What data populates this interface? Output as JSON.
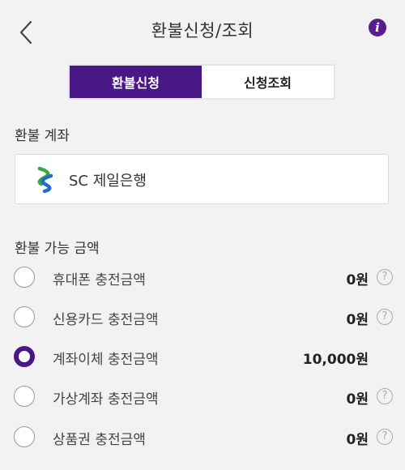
{
  "header": {
    "title": "환불신청/조회",
    "info_icon_glyph": "i",
    "icons": {
      "back": "chevron-left-icon",
      "info": "info-icon"
    }
  },
  "tabs": [
    {
      "label": "환불신청",
      "active": true
    },
    {
      "label": "신청조회",
      "active": false
    }
  ],
  "refund_account": {
    "label": "환불 계좌",
    "bank_name": "SC 제일은행",
    "bank_logo": "sc-bank-logo"
  },
  "refundable": {
    "label": "환불 가능 금액",
    "items": [
      {
        "label": "휴대폰 충전금액",
        "amount": "0원",
        "selected": false,
        "help": "?"
      },
      {
        "label": "신용카드 충전금액",
        "amount": "0원",
        "selected": false,
        "help": "?"
      },
      {
        "label": "계좌이체 충전금액",
        "amount": "10,000원",
        "selected": true,
        "help": ""
      },
      {
        "label": "가상계좌 충전금액",
        "amount": "0원",
        "selected": false,
        "help": "?"
      },
      {
        "label": "상품권 충전금액",
        "amount": "0원",
        "selected": false,
        "help": "?"
      }
    ]
  },
  "colors": {
    "accent": "#4a1786",
    "background": "#f2f2f2",
    "logo_blue": "#1e6fc6",
    "logo_green": "#3aa83a"
  }
}
